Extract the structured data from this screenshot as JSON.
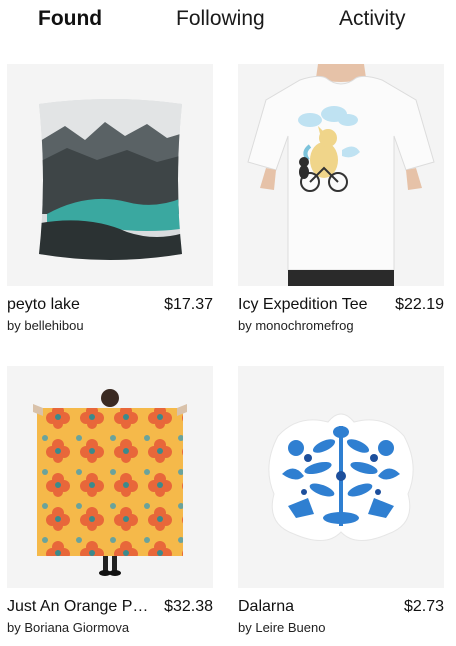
{
  "tabs": [
    {
      "label": "Found",
      "active": true
    },
    {
      "label": "Following",
      "active": false
    },
    {
      "label": "Activity",
      "active": false
    }
  ],
  "products": [
    {
      "title": "peyto lake",
      "price": "$17.37",
      "artist": "by bellehibou",
      "image": "throw-pillow-mountain-lake"
    },
    {
      "title": "Icy Expedition Tee",
      "price": "$22.19",
      "artist": "by monochromefrog",
      "image": "white-tshirt-bear-bicycle"
    },
    {
      "title": "Just An Orange Pattern",
      "price": "$32.38",
      "artist": "by Boriana Giormova",
      "image": "scarf-orange-floral-pattern"
    },
    {
      "title": "Dalarna",
      "price": "$2.73",
      "artist": "by Leire Bueno",
      "image": "sticker-blue-folk-art"
    }
  ],
  "colors": {
    "lake": "#3aa8a0",
    "scarf": "#f5b94a",
    "pattern": "#e8673a",
    "folk_blue": "#2f7fd1"
  }
}
